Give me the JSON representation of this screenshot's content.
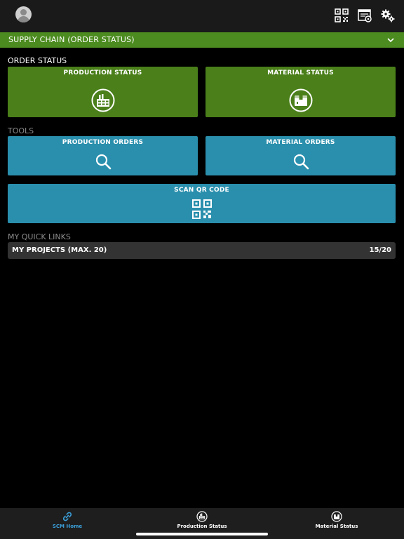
{
  "header": {
    "icons": [
      "avatar",
      "qr-code-icon",
      "settings-panel-icon",
      "gears-icon"
    ]
  },
  "section": {
    "title": "SUPPLY CHAIN  (ORDER STATUS)"
  },
  "order_status": {
    "heading": "ORDER STATUS",
    "tiles": [
      {
        "label": "PRODUCTION STATUS",
        "icon": "factory-icon"
      },
      {
        "label": "MATERIAL STATUS",
        "icon": "material-box-icon"
      }
    ]
  },
  "tools": {
    "heading": "TOOLS",
    "tiles": [
      {
        "label": "PRODUCTION ORDERS",
        "icon": "search-icon"
      },
      {
        "label": "MATERIAL ORDERS",
        "icon": "search-icon"
      },
      {
        "label": "SCAN QR CODE",
        "icon": "qr-code-icon"
      }
    ]
  },
  "quick_links": {
    "heading": "MY QUICK LINKS",
    "items": [
      {
        "label": "MY PROJECTS (MAX. 20)",
        "count": "15/20"
      }
    ]
  },
  "tabbar": {
    "tabs": [
      {
        "label": "SCM Home",
        "icon": "link-icon",
        "active": true
      },
      {
        "label": "Production Status",
        "icon": "factory-icon",
        "active": false
      },
      {
        "label": "Material Status",
        "icon": "material-box-icon",
        "active": false
      }
    ]
  },
  "colors": {
    "green_bar": "#4c8b1f",
    "green_tile": "#4a7f1a",
    "blue_tile": "#2a8fad",
    "active_tab": "#3b9fd9"
  }
}
